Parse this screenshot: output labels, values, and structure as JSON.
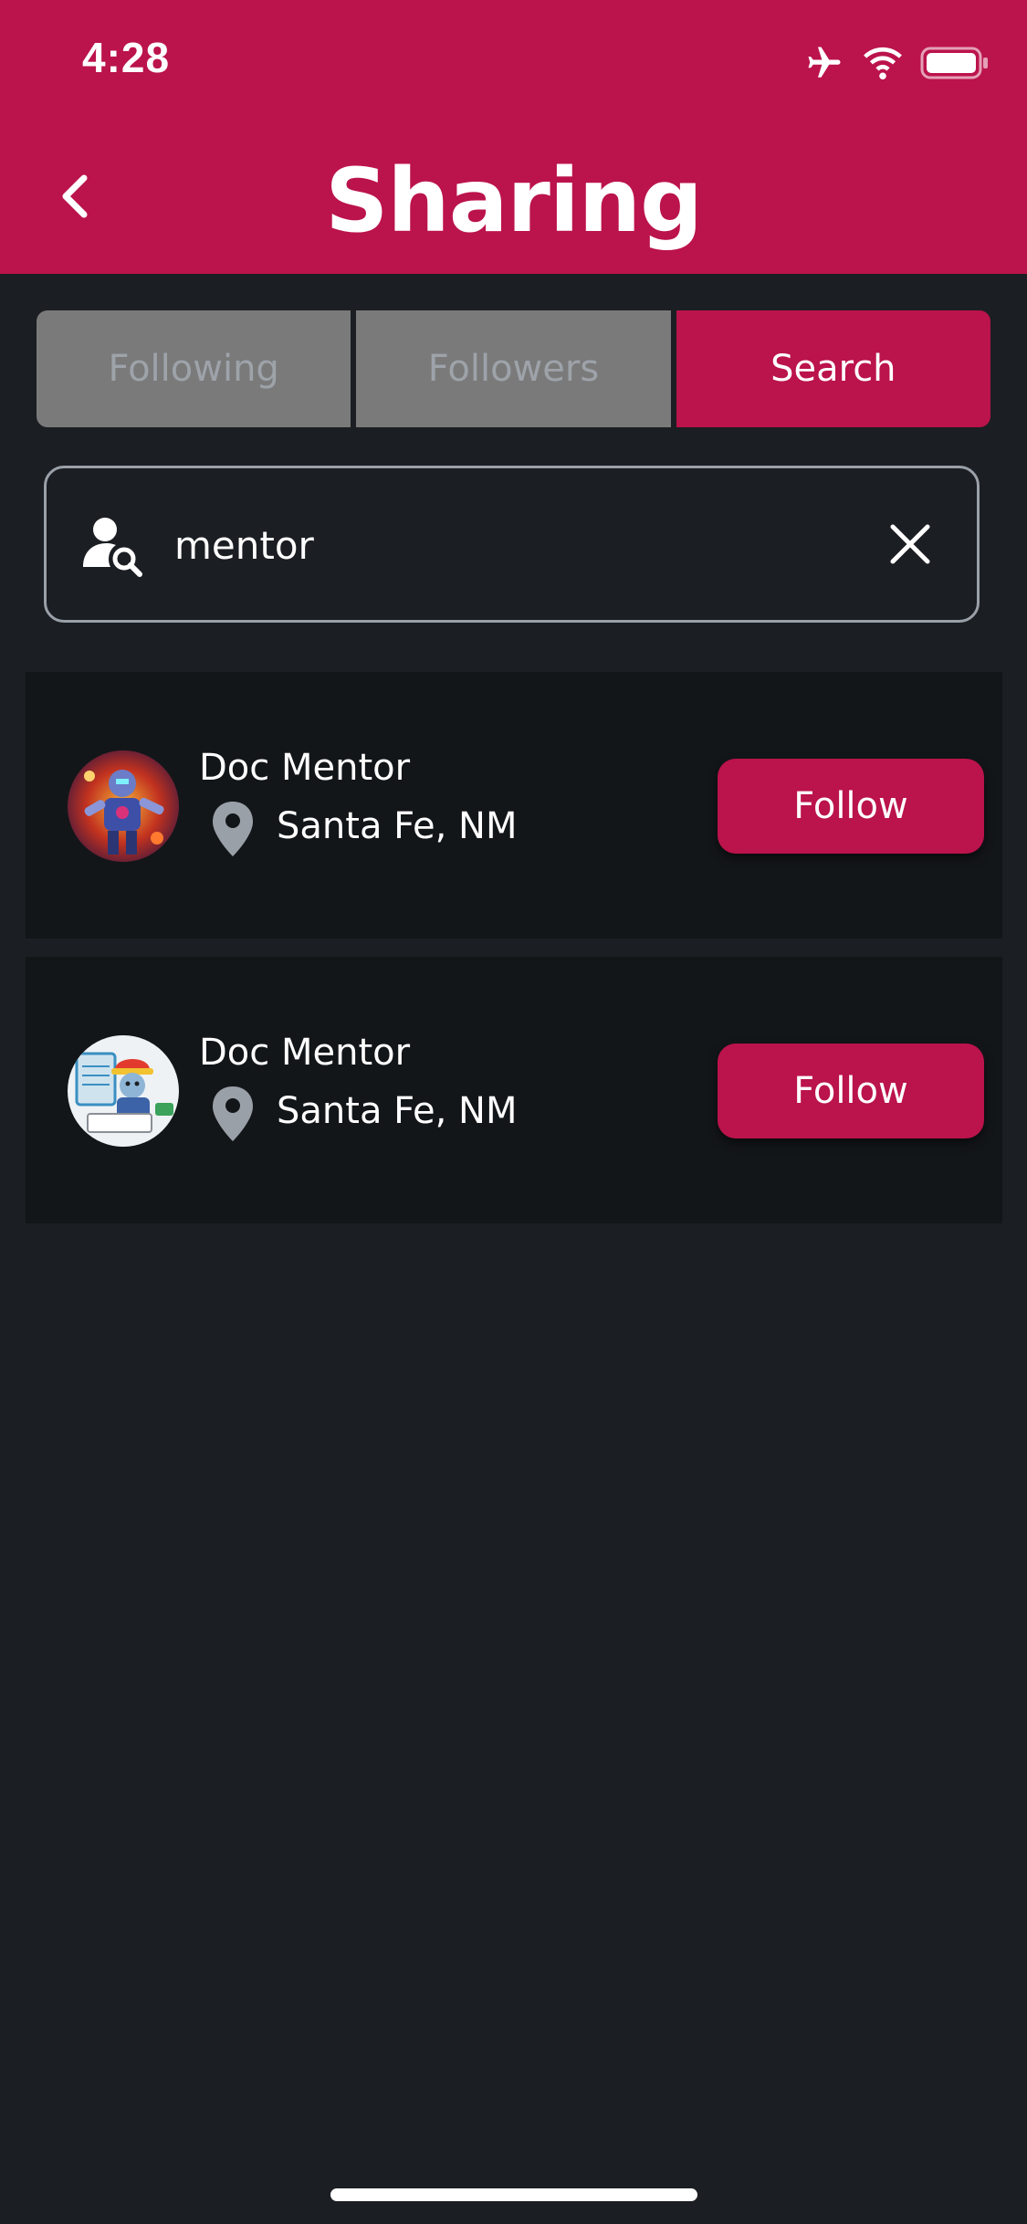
{
  "status_bar": {
    "time": "4:28",
    "icons": [
      "airplane-icon",
      "wifi-icon",
      "battery-icon"
    ]
  },
  "header": {
    "title": "Sharing",
    "back_icon": "chevron-left-icon"
  },
  "tabs": [
    {
      "label": "Following",
      "active": false
    },
    {
      "label": "Followers",
      "active": false
    },
    {
      "label": "Search",
      "active": true
    }
  ],
  "search": {
    "value": "mentor",
    "icon": "user-search-icon",
    "clear_icon": "close-icon"
  },
  "results": [
    {
      "name": "Doc Mentor",
      "location": "Santa Fe, NM",
      "button": "Follow",
      "avatar": "robot-avatar"
    },
    {
      "name": "Doc Mentor",
      "location": "Santa Fe, NM",
      "button": "Follow",
      "avatar": "firefighter-avatar"
    }
  ],
  "colors": {
    "accent": "#bb134b",
    "background": "#1b1e22",
    "card": "#131619",
    "tab_inactive": "#7a7a7a"
  }
}
